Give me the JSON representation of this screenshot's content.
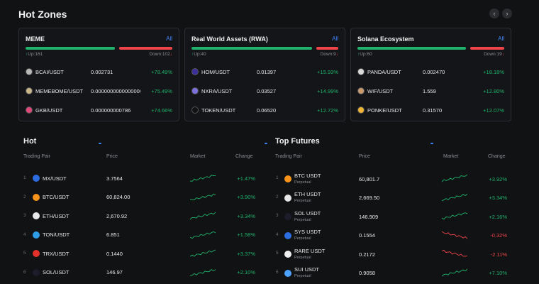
{
  "header": {
    "title": "Hot Zones",
    "prev_icon": "chevron-left-icon",
    "next_icon": "chevron-right-icon"
  },
  "zones": [
    {
      "title": "MEME",
      "all": "All",
      "up": "Up:161",
      "down": "Down:102",
      "up_fraction": 0.61,
      "rows": [
        {
          "pair": "BCAI/USDT",
          "price": "0.002731",
          "change": "+78.49%",
          "icon": "bcai-coin-icon",
          "color": "#b8b8b8"
        },
        {
          "pair": "MEMEBOME/USDT",
          "price": "0.000000000000000000",
          "change": "+75.49%",
          "icon": "memebome-coin-icon",
          "color": "#c9b58a"
        },
        {
          "pair": "GKB/USDT",
          "price": "0.000000000786",
          "change": "+74.66%",
          "icon": "gkb-coin-icon",
          "color": "#e0487a"
        }
      ]
    },
    {
      "title": "Real World Assets (RWA)",
      "all": "All",
      "up": "Up:40",
      "down": "Down:9",
      "up_fraction": 0.82,
      "rows": [
        {
          "pair": "HOM/USDT",
          "price": "0.01397",
          "change": "+15.93%",
          "icon": "hom-coin-icon",
          "color": "#3b2f9e"
        },
        {
          "pair": "NXRA/USDT",
          "price": "0.03527",
          "change": "+14.99%",
          "icon": "nxra-coin-icon",
          "color": "#7b6fe0"
        },
        {
          "pair": "TOKEN/USDT",
          "price": "0.06520",
          "change": "+12.72%",
          "icon": "token-coin-icon",
          "color": "#111214"
        }
      ]
    },
    {
      "title": "Solana Ecosystem",
      "all": "All",
      "up": "Up:60",
      "down": "Down:19",
      "up_fraction": 0.74,
      "rows": [
        {
          "pair": "PANDA/USDT",
          "price": "0.002470",
          "change": "+18.18%",
          "icon": "panda-coin-icon",
          "color": "#d9d9d9"
        },
        {
          "pair": "WIF/USDT",
          "price": "1.559",
          "change": "+12.80%",
          "icon": "wif-coin-icon",
          "color": "#c89a6e"
        },
        {
          "pair": "PONKE/USDT",
          "price": "0.31570",
          "change": "+12.07%",
          "icon": "ponke-coin-icon",
          "color": "#f2b233"
        }
      ]
    }
  ],
  "hot": {
    "title": "Hot",
    "headers": {
      "pair": "Trading Pair",
      "price": "Price",
      "market": "Market",
      "change": "Change"
    },
    "rows": [
      {
        "rank": "1",
        "pair": "MX/USDT",
        "price": "3.7564",
        "change": "+1.47%",
        "icon": "mx-coin-icon",
        "color": "#2d6be0",
        "trend": "up"
      },
      {
        "rank": "2",
        "pair": "BTC/USDT",
        "price": "60,824.00",
        "change": "+3.90%",
        "icon": "btc-coin-icon",
        "color": "#f7931a",
        "trend": "up"
      },
      {
        "rank": "3",
        "pair": "ETH/USDT",
        "price": "2,670.92",
        "change": "+3.34%",
        "icon": "eth-coin-icon",
        "color": "#e8e8e8",
        "trend": "up"
      },
      {
        "rank": "4",
        "pair": "TON/USDT",
        "price": "6.851",
        "change": "+1.58%",
        "icon": "ton-coin-icon",
        "color": "#2f9ce8",
        "trend": "up"
      },
      {
        "rank": "5",
        "pair": "TRX/USDT",
        "price": "0.1440",
        "change": "+3.37%",
        "icon": "trx-coin-icon",
        "color": "#e3302a",
        "trend": "up"
      },
      {
        "rank": "6",
        "pair": "SOL/USDT",
        "price": "146.97",
        "change": "+2.10%",
        "icon": "sol-coin-icon",
        "color": "#1c1c2a",
        "trend": "up"
      }
    ]
  },
  "futures": {
    "title": "Top Futures",
    "headers": {
      "pair": "Trading Pair",
      "price": "Price",
      "market": "Market",
      "change": "Change"
    },
    "rows": [
      {
        "rank": "1",
        "pair": "BTC USDT",
        "sub": "Perpetual",
        "price": "60,801.7",
        "change": "+3.92%",
        "icon": "btc-coin-icon",
        "color": "#f7931a",
        "trend": "up"
      },
      {
        "rank": "2",
        "pair": "ETH USDT",
        "sub": "Perpetual",
        "price": "2,669.50",
        "change": "+3.34%",
        "icon": "eth-coin-icon",
        "color": "#e8e8e8",
        "trend": "up"
      },
      {
        "rank": "3",
        "pair": "SOL USDT",
        "sub": "Perpetual",
        "price": "146.909",
        "change": "+2.16%",
        "icon": "sol-coin-icon",
        "color": "#1c1c2a",
        "trend": "up"
      },
      {
        "rank": "4",
        "pair": "SYS USDT",
        "sub": "Perpetual",
        "price": "0.1554",
        "change": "-0.32%",
        "icon": "sys-coin-icon",
        "color": "#2a6ee0",
        "trend": "down"
      },
      {
        "rank": "5",
        "pair": "RARE USDT",
        "sub": "Perpetual",
        "price": "0.2172",
        "change": "-2.11%",
        "icon": "rare-coin-icon",
        "color": "#f0f0f0",
        "trend": "down"
      },
      {
        "rank": "6",
        "pair": "SUI USDT",
        "sub": "Perpetual",
        "price": "0.9058",
        "change": "+7.10%",
        "icon": "sui-coin-icon",
        "color": "#4da2ff",
        "trend": "up"
      }
    ]
  }
}
